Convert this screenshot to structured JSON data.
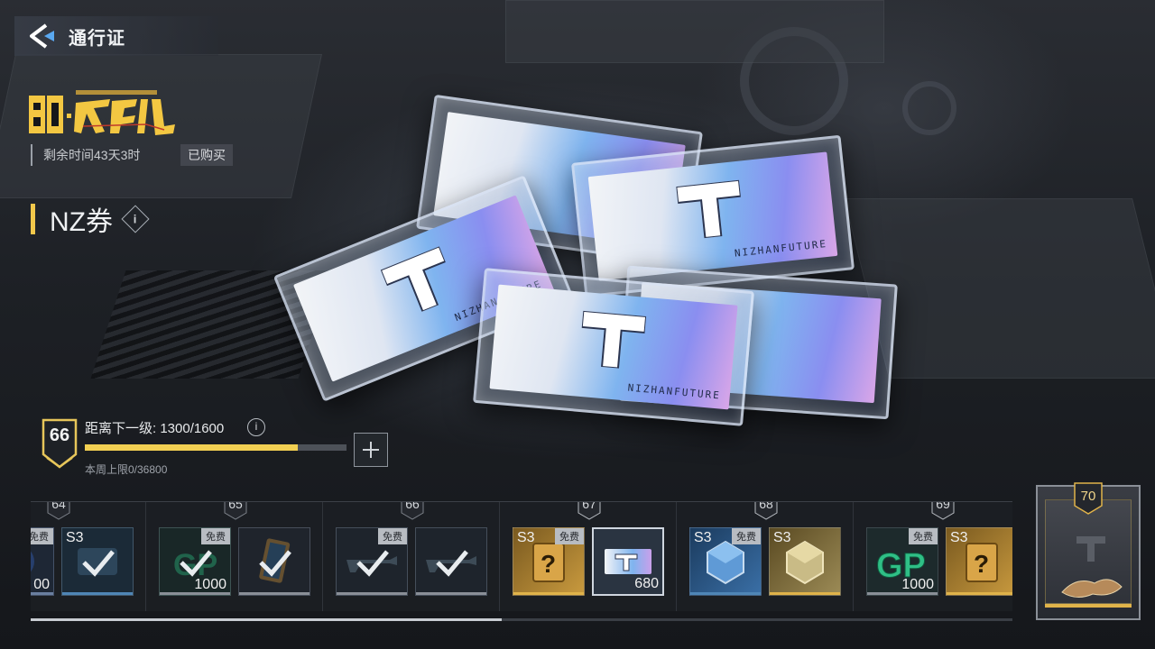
{
  "header": {
    "title": "通行证"
  },
  "season": {
    "remaining_time": "剩余时间43天3时",
    "purchased_label": "已购买"
  },
  "item": {
    "name": "NZ券",
    "info_label": "i"
  },
  "level": {
    "current": "66",
    "next_label": "距离下一级: 1300/1600",
    "info_label": "i",
    "progress": 0.8125,
    "weekly_limit": "本周上限0/36800"
  },
  "tiers": [
    {
      "level": "64"
    },
    {
      "level": "65"
    },
    {
      "level": "66"
    },
    {
      "level": "67"
    },
    {
      "level": "68"
    },
    {
      "level": "69"
    },
    {
      "level": "70"
    }
  ],
  "rewards": {
    "t64a": {
      "free": "免费",
      "qty": "00"
    },
    "t64b": {
      "tag": "S3"
    },
    "t65a": {
      "free": "免费",
      "qty": "1000"
    },
    "t66a": {
      "free": "免费"
    },
    "t67a": {
      "tag": "S3",
      "free": "免费"
    },
    "t67b": {
      "qty": "680"
    },
    "t68a": {
      "tag": "S3",
      "free": "免费"
    },
    "t68b": {
      "tag": "S3"
    },
    "t69a": {
      "free": "免费",
      "qty": "1000"
    },
    "t69b": {
      "tag": "S3"
    }
  },
  "scroll": {
    "position": 0.48
  },
  "colors": {
    "accent_gold": "#f2cf52",
    "free_tag": "#b8bcc2",
    "gp_green": "#2fbf86"
  },
  "icons": [
    "back-arrow-icon",
    "info-icon",
    "plus-icon",
    "check-icon",
    "mystery-box-icon",
    "gp-coin-icon",
    "nz-ticket-icon",
    "crate-icon"
  ]
}
